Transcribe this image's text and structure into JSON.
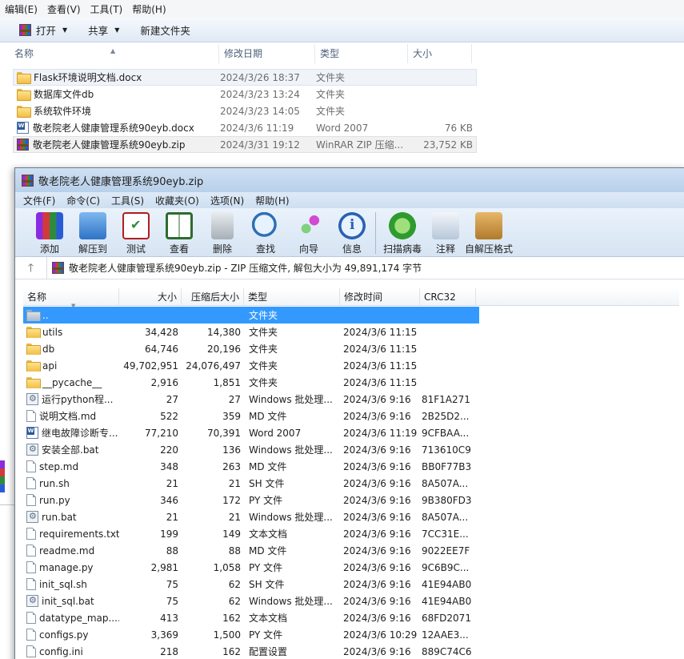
{
  "explorer": {
    "menu": [
      "编辑(E)",
      "查看(V)",
      "工具(T)",
      "帮助(H)"
    ],
    "toolbar": {
      "open": "打开",
      "share": "共享",
      "new_folder": "新建文件夹"
    },
    "columns": [
      "名称",
      "修改日期",
      "类型",
      "大小"
    ],
    "rows": [
      {
        "icon": "folder",
        "name": "Flask环境说明文档.docx",
        "date": "2024/3/26 18:37",
        "type": "文件夹",
        "size": ""
      },
      {
        "icon": "folder",
        "name": "数据库文件db",
        "date": "2024/3/23 13:24",
        "type": "文件夹",
        "size": ""
      },
      {
        "icon": "folder",
        "name": "系统软件环境",
        "date": "2024/3/23 14:05",
        "type": "文件夹",
        "size": ""
      },
      {
        "icon": "word",
        "name": "敬老院老人健康管理系统90eyb.docx",
        "date": "2024/3/6 11:19",
        "type": "Word 2007",
        "size": "76 KB"
      },
      {
        "icon": "rar",
        "name": "敬老院老人健康管理系统90eyb.zip",
        "date": "2024/3/31 19:12",
        "type": "WinRAR ZIP 压缩...",
        "size": "23,752 KB"
      }
    ]
  },
  "winrar": {
    "title": "敬老院老人健康管理系统90eyb.zip",
    "menu": [
      "文件(F)",
      "命令(C)",
      "工具(S)",
      "收藏夹(O)",
      "选项(N)",
      "帮助(H)"
    ],
    "tools": {
      "add": "添加",
      "extract": "解压到",
      "test": "测试",
      "view": "查看",
      "delete": "删除",
      "find": "查找",
      "wizard": "向导",
      "info": "信息",
      "scan": "扫描病毒",
      "comment": "注释",
      "sfx": "自解压格式"
    },
    "address": "敬老院老人健康管理系统90eyb.zip - ZIP 压缩文件, 解包大小为 49,891,174 字节",
    "columns": {
      "name": "名称",
      "size": "大小",
      "packed": "压缩后大小",
      "type": "类型",
      "modified": "修改时间",
      "crc": "CRC32"
    },
    "rows": [
      {
        "icon": "folder-grey",
        "name": "..",
        "size": "",
        "packed": "",
        "type": "文件夹",
        "modified": "",
        "crc": ""
      },
      {
        "icon": "folder",
        "name": "utils",
        "size": "34,428",
        "packed": "14,380",
        "type": "文件夹",
        "modified": "2024/3/6 11:15",
        "crc": ""
      },
      {
        "icon": "folder",
        "name": "db",
        "size": "64,746",
        "packed": "20,196",
        "type": "文件夹",
        "modified": "2024/3/6 11:15",
        "crc": ""
      },
      {
        "icon": "folder",
        "name": "api",
        "size": "49,702,951",
        "packed": "24,076,497",
        "type": "文件夹",
        "modified": "2024/3/6 11:15",
        "crc": ""
      },
      {
        "icon": "folder",
        "name": "__pycache__",
        "size": "2,916",
        "packed": "1,851",
        "type": "文件夹",
        "modified": "2024/3/6 11:15",
        "crc": ""
      },
      {
        "icon": "bat",
        "name": "运行python程...",
        "size": "27",
        "packed": "27",
        "type": "Windows 批处理...",
        "modified": "2024/3/6 9:16",
        "crc": "81F1A271"
      },
      {
        "icon": "file",
        "name": "说明文档.md",
        "size": "522",
        "packed": "359",
        "type": "MD 文件",
        "modified": "2024/3/6 9:16",
        "crc": "2B25D2..."
      },
      {
        "icon": "word",
        "name": "继电故障诊断专...",
        "size": "77,210",
        "packed": "70,391",
        "type": "Word 2007",
        "modified": "2024/3/6 11:19",
        "crc": "9CFBAA..."
      },
      {
        "icon": "bat",
        "name": "安装全部.bat",
        "size": "220",
        "packed": "136",
        "type": "Windows 批处理...",
        "modified": "2024/3/6 9:16",
        "crc": "713610C9"
      },
      {
        "icon": "file",
        "name": "step.md",
        "size": "348",
        "packed": "263",
        "type": "MD 文件",
        "modified": "2024/3/6 9:16",
        "crc": "BB0F77B3"
      },
      {
        "icon": "file",
        "name": "run.sh",
        "size": "21",
        "packed": "21",
        "type": "SH 文件",
        "modified": "2024/3/6 9:16",
        "crc": "8A507A..."
      },
      {
        "icon": "file",
        "name": "run.py",
        "size": "346",
        "packed": "172",
        "type": "PY 文件",
        "modified": "2024/3/6 9:16",
        "crc": "9B380FD3"
      },
      {
        "icon": "bat",
        "name": "run.bat",
        "size": "21",
        "packed": "21",
        "type": "Windows 批处理...",
        "modified": "2024/3/6 9:16",
        "crc": "8A507A..."
      },
      {
        "icon": "file",
        "name": "requirements.txt",
        "size": "199",
        "packed": "149",
        "type": "文本文档",
        "modified": "2024/3/6 9:16",
        "crc": "7CC31E..."
      },
      {
        "icon": "file",
        "name": "readme.md",
        "size": "88",
        "packed": "88",
        "type": "MD 文件",
        "modified": "2024/3/6 9:16",
        "crc": "9022EE7F"
      },
      {
        "icon": "file",
        "name": "manage.py",
        "size": "2,981",
        "packed": "1,058",
        "type": "PY 文件",
        "modified": "2024/3/6 9:16",
        "crc": "9C6B9C..."
      },
      {
        "icon": "file",
        "name": "init_sql.sh",
        "size": "75",
        "packed": "62",
        "type": "SH 文件",
        "modified": "2024/3/6 9:16",
        "crc": "41E94AB0"
      },
      {
        "icon": "bat",
        "name": "init_sql.bat",
        "size": "75",
        "packed": "62",
        "type": "Windows 批处理...",
        "modified": "2024/3/6 9:16",
        "crc": "41E94AB0"
      },
      {
        "icon": "file",
        "name": "datatype_map....",
        "size": "413",
        "packed": "162",
        "type": "文本文档",
        "modified": "2024/3/6 9:16",
        "crc": "68FD2071"
      },
      {
        "icon": "file",
        "name": "configs.py",
        "size": "3,369",
        "packed": "1,500",
        "type": "PY 文件",
        "modified": "2024/3/6 10:29",
        "crc": "12AAE3..."
      },
      {
        "icon": "file",
        "name": "config.ini",
        "size": "218",
        "packed": "162",
        "type": "配置设置",
        "modified": "2024/3/6 9:16",
        "crc": "889C74C6"
      }
    ]
  }
}
